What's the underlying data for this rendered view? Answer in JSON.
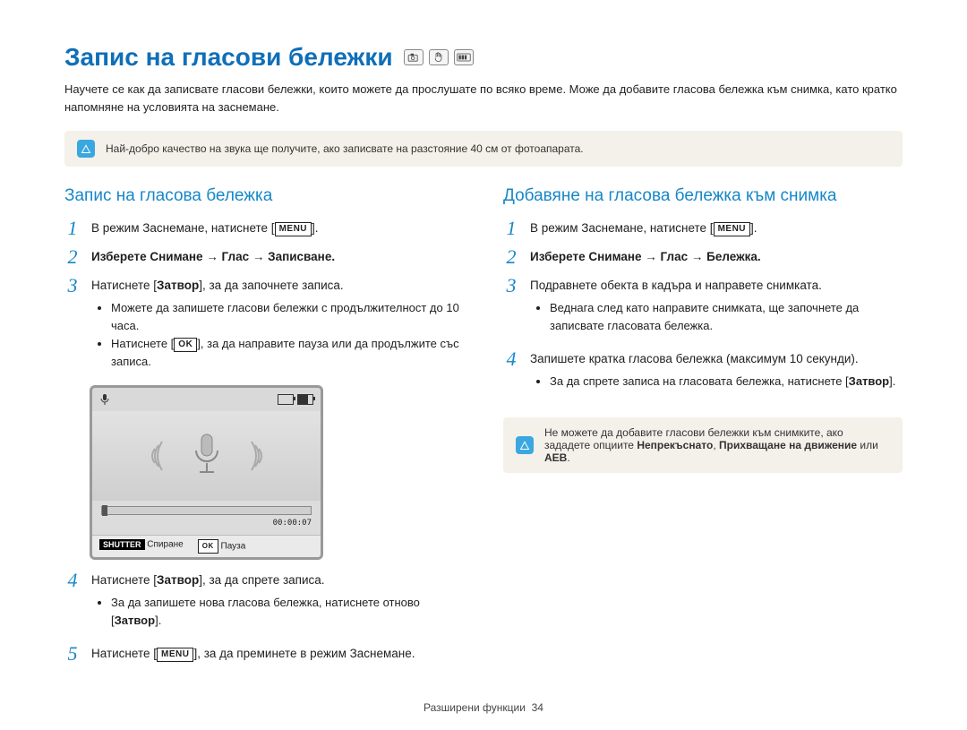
{
  "page_title": "Запис на гласови бележки",
  "intro": "Научете се как да записвате гласови бележки, които можете да прослушате по всяко време. Може да добавите гласова бележка към снимка, като кратко напомняне на условията на заснемане.",
  "top_note": "Най-добро качество на звука ще получите, ако записвате на разстояние 40 см от фотоапарата.",
  "keys": {
    "menu": "MENU",
    "ok": "OK",
    "shutter": "SHUTTER"
  },
  "left": {
    "title": "Запис на гласова бележка",
    "steps": [
      {
        "num": "1",
        "pre": "В режим Заснемане, натиснете [",
        "post": "]."
      },
      {
        "num": "2",
        "text": "Изберете Снимане → Глас → Записване."
      },
      {
        "num": "3",
        "pre": "Натиснете [",
        "bold": "Затвор",
        "post": "], за да започнете записа.",
        "bullets": [
          "Можете да запишете гласови бележки с продължителност до 10 часа.",
          "Натиснете [OK], за да направите пауза или да продължите със записа."
        ]
      },
      {
        "num": "4",
        "pre": "Натиснете [",
        "bold": "Затвор",
        "post": "], за да спрете записа.",
        "bullets": [
          "За да запишете нова гласова бележка, натиснете отново [Затвор]."
        ]
      },
      {
        "num": "5",
        "pre": "Натиснете [",
        "post": "], за да преминете в режим Заснемане."
      }
    ],
    "device": {
      "time": "00:00:07",
      "stop": "Спиране",
      "pause": "Пауза"
    }
  },
  "right": {
    "title": "Добавяне на гласова бележка към снимка",
    "steps": [
      {
        "num": "1",
        "pre": "В режим Заснемане, натиснете [",
        "post": "]."
      },
      {
        "num": "2",
        "text": "Изберете Снимане → Глас → Бележка."
      },
      {
        "num": "3",
        "text": "Подравнете обекта в кадъра и направете снимката.",
        "bullets": [
          "Веднага след като направите снимката, ще започнете да записвате гласовата бележка."
        ]
      },
      {
        "num": "4",
        "text": "Запишете кратка гласова бележка (максимум 10 секунди).",
        "bullets": [
          "За да спрете записа на гласовата бележка, натиснете [Затвор]."
        ]
      }
    ],
    "note": "Не можете да добавите гласови бележки към снимките, ако зададете опциите Непрекъснато, Прихващане на движение или AEB."
  },
  "footer": {
    "section": "Разширени функции",
    "page": "34"
  }
}
